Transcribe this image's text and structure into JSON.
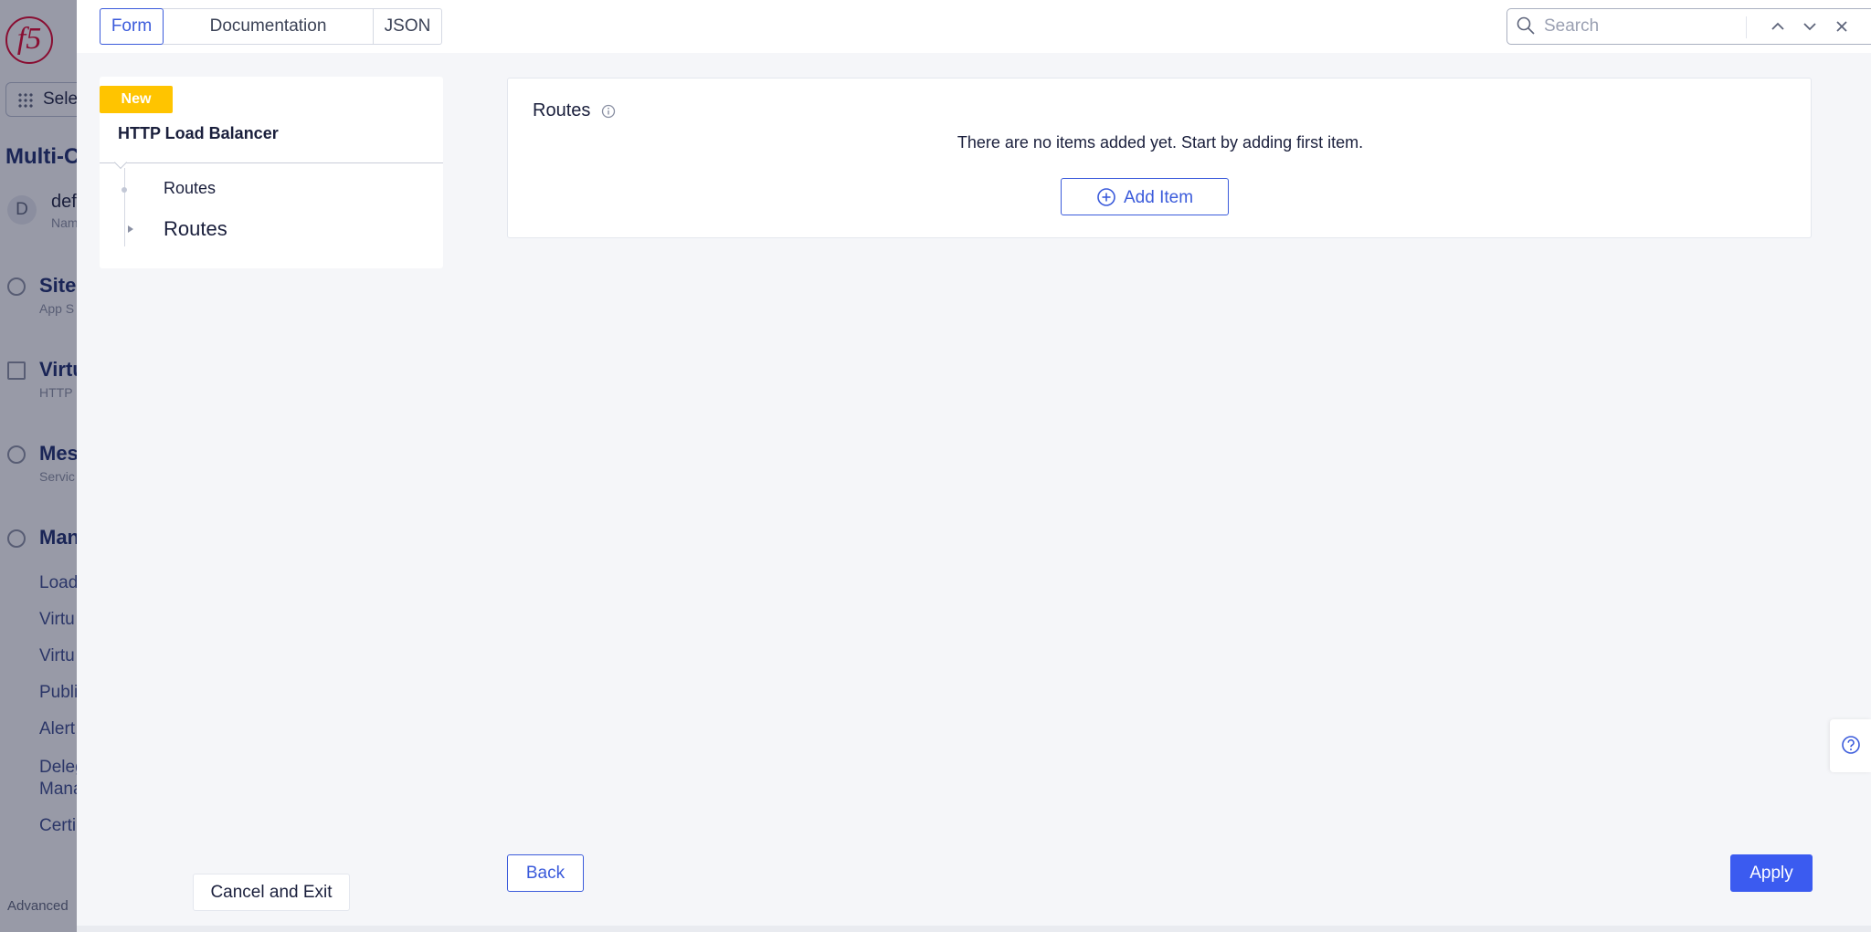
{
  "background": {
    "select_label": "Sele",
    "app_title": "Multi-C",
    "namespace": {
      "avatar": "D",
      "name": "def",
      "sub": "Nam"
    },
    "nav": [
      {
        "label": "Sites",
        "sub": "App S"
      },
      {
        "label": "Virtu",
        "sub": "HTTP"
      },
      {
        "label": "Mes",
        "sub": "Servic"
      },
      {
        "label": "Man",
        "sub": ""
      }
    ],
    "links": [
      "Load",
      "Virtu",
      "Virtu",
      "Publi",
      "Alert",
      "Deleg",
      "Mana",
      "Certi"
    ],
    "advanced": "Advanced"
  },
  "tabs": {
    "form": "Form",
    "documentation": "Documentation",
    "json": "JSON"
  },
  "search": {
    "placeholder": "Search",
    "value": ""
  },
  "nav_panel": {
    "badge": "New",
    "title": "HTTP Load Balancer",
    "tree": [
      "Routes",
      "Routes"
    ]
  },
  "routes": {
    "label": "Routes",
    "empty_message": "There are no items added yet. Start by adding first item.",
    "add_item": "Add Item"
  },
  "actions": {
    "cancel": "Cancel and Exit",
    "back": "Back",
    "apply": "Apply"
  },
  "colors": {
    "accent": "#3b5bdb",
    "badge": "#ffc400",
    "apply": "#3b5bf0",
    "brand_red": "#e4002b"
  }
}
